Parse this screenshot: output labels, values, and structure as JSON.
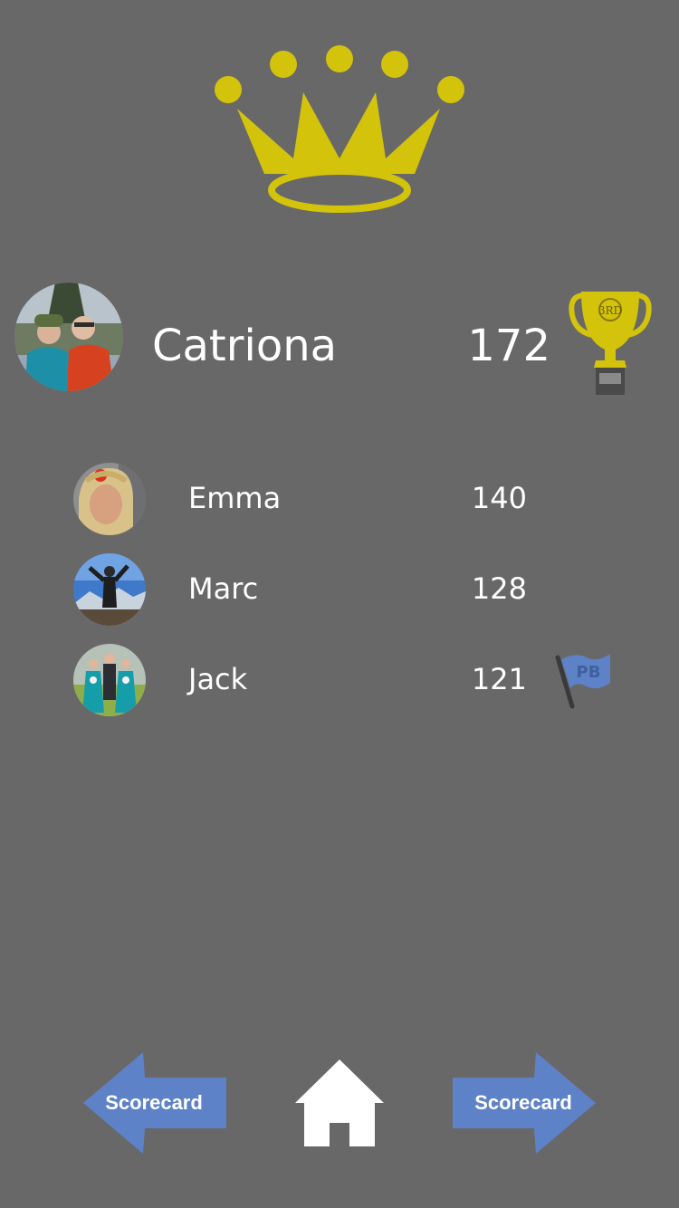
{
  "icons": {
    "crown": "crown-icon",
    "trophy": "trophy-icon",
    "pb_flag": "pb-flag-icon",
    "home": "home-icon",
    "back_arrow": "left-arrow-icon",
    "next_arrow": "right-arrow-icon"
  },
  "colors": {
    "background": "#686868",
    "crown": "#d3c30b",
    "trophy": "#d3c30b",
    "nav_arrow": "#5e82c8",
    "text": "#ffffff"
  },
  "winner": {
    "name": "Catriona",
    "score": "172",
    "trophy_badge": "3RD"
  },
  "players": [
    {
      "name": "Emma",
      "score": "140"
    },
    {
      "name": "Marc",
      "score": "128"
    },
    {
      "name": "Jack",
      "score": "121",
      "badge": "PB"
    }
  ],
  "nav": {
    "left_label": "Scorecard",
    "right_label": "Scorecard"
  }
}
